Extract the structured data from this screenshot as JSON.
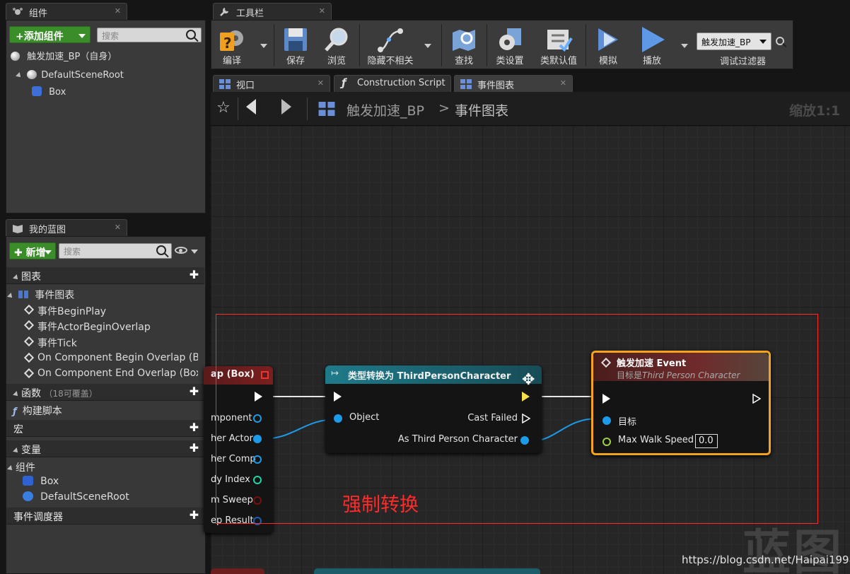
{
  "components_panel": {
    "tab_label": "组件",
    "add_button": "+添加组件",
    "search_placeholder": "搜索",
    "self_label": "触发加速_BP（自身）",
    "tree": [
      "DefaultSceneRoot",
      "Box"
    ]
  },
  "blueprint_panel": {
    "tab_label": "我的蓝图",
    "new_button": "新增",
    "search_placeholder": "搜索",
    "graphs_section": "图表",
    "event_graph": "事件图表",
    "events": [
      "事件BeginPlay",
      "事件ActorBeginOverlap",
      "事件Tick",
      "On Component Begin Overlap (Box)",
      "On Component End Overlap (Box)"
    ],
    "functions_section": "函数",
    "functions_hint": "（18可覆盖）",
    "construction_script": "构建脚本",
    "macros_section": "宏",
    "variables_section": "变量",
    "components_group": "组件",
    "component_vars": [
      "Box",
      "DefaultSceneRoot"
    ],
    "dispatchers_section": "事件调度器"
  },
  "toolbar": {
    "tab_label": "工具栏",
    "buttons": [
      "编译",
      "保存",
      "浏览",
      "隐藏不相关",
      "查找",
      "类设置",
      "类默认值",
      "模拟",
      "播放"
    ],
    "debug_object": "触发加速_BP",
    "debug_filter_label": "调试过滤器"
  },
  "editor_tabs": [
    "视口",
    "Construction Script",
    "事件图表"
  ],
  "breadcrumb": {
    "blueprint": "触发加速_BP",
    "separator": ">",
    "graph": "事件图表",
    "zoom": "缩放1:1"
  },
  "graph": {
    "overlap_node": {
      "title": "ap (Box)",
      "pins": [
        "mponent",
        "her Actor",
        "her Comp",
        "dy Index",
        "m Sweep",
        "ep Result"
      ]
    },
    "cast_node": {
      "title": "类型转换为 ThirdPersonCharacter",
      "input_pin": "Object",
      "cast_failed": "Cast Failed",
      "output_pin": "As Third Person Character"
    },
    "event_node": {
      "title": "触发加速 Event",
      "subtitle_prefix": "目标是",
      "subtitle_target": "Third Person Character",
      "target_pin": "目标",
      "speed_pin": "Max Walk Speed",
      "speed_value": "0.0"
    },
    "annotation": "强制转换",
    "annotation_color": "#ff2a2a"
  },
  "watermark": {
    "logo_text": "蓝图",
    "url": "https://blog.csdn.net/Haipai1998"
  },
  "colors": {
    "exec": "#ffffff",
    "object_pin": "#1d9be8",
    "float_pin": "#9ed044",
    "struct_pin": "#1a5fb0",
    "bool_pin": "#7a0e0e",
    "int_pin": "#1fd6a8",
    "cast_header": "#1c6c7a",
    "event_header": "#7b1f1f",
    "selection": "#f5a21d"
  }
}
